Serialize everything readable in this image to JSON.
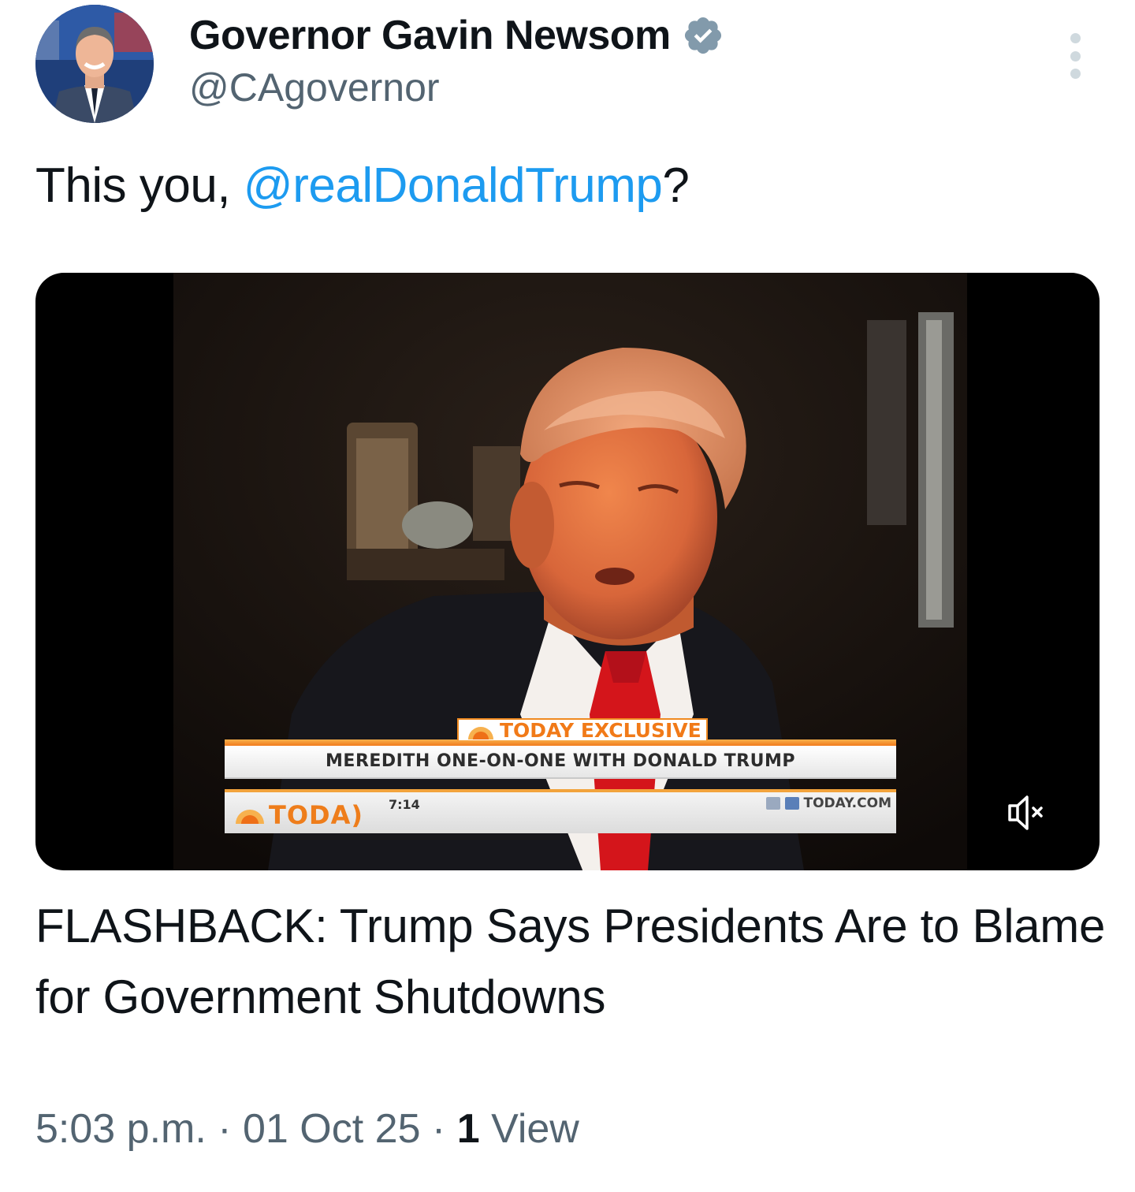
{
  "author": {
    "display_name": "Governor Gavin Newsom",
    "handle": "@CAgovernor",
    "verified": true,
    "avatar": "profile-photo"
  },
  "tweet": {
    "text_before": "This you, ",
    "mention": "@realDonaldTrump",
    "text_after": "?"
  },
  "media": {
    "type": "video",
    "overlay": {
      "exclusive_tag": "TODAY EXCLUSIVE",
      "lower_third": "MEREDITH ONE-ON-ONE WITH DONALD TRUMP",
      "logo": "TODA)",
      "clock": "7:14",
      "website": "TODAY.COM"
    },
    "mute_icon": "speaker-muted-icon"
  },
  "link_card": {
    "title": "FLASHBACK: Trump Says Presidents Are to Blame for Government Shutdowns"
  },
  "meta": {
    "time": "5:03 p.m.",
    "separator": " · ",
    "date": "01 Oct 25",
    "views_count": "1",
    "views_label": "View"
  },
  "colors": {
    "mention": "#1d9bf0",
    "verified": "#829aab",
    "secondary_text": "#536471",
    "primary_text": "#0f1419",
    "ticker_orange": "#f17a18"
  }
}
